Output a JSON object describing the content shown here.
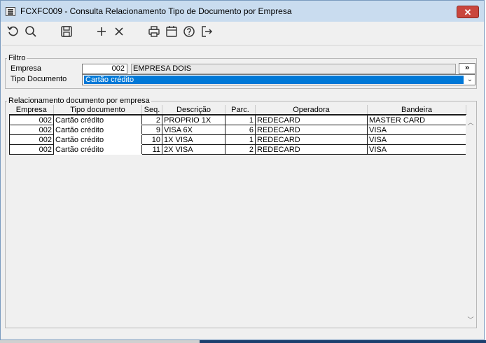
{
  "window": {
    "title": "FCXFC009 - Consulta Relacionamento Tipo de Documento por Empresa",
    "close_label": "✕"
  },
  "toolbar": {
    "icons": [
      "refresh-icon",
      "search-icon",
      "save-icon",
      "add-icon",
      "delete-icon",
      "print-icon",
      "calendar-icon",
      "help-icon",
      "exit-icon"
    ]
  },
  "filtro": {
    "legend": "Filtro",
    "empresa_label": "Empresa",
    "empresa_code": "002",
    "empresa_name": "EMPRESA DOIS",
    "lookup_label": "»",
    "tipo_label": "Tipo Documento",
    "tipo_value": "Cartão crédito"
  },
  "relacionamento": {
    "legend": "Relacionamento documento por empresa",
    "columns": [
      "Empresa",
      "Tipo documento",
      "Seq.",
      "Descrição",
      "Parc.",
      "Operadora",
      "Bandeira"
    ],
    "rows": [
      {
        "empresa": "002",
        "tipo": "Cartão crédito",
        "seq": "2",
        "descricao": "PROPRIO 1X",
        "parc": "1",
        "operadora": "REDECARD",
        "bandeira": "MASTER CARD"
      },
      {
        "empresa": "002",
        "tipo": "Cartão crédito",
        "seq": "9",
        "descricao": "VISA 6X",
        "parc": "6",
        "operadora": "REDECARD",
        "bandeira": "VISA"
      },
      {
        "empresa": "002",
        "tipo": "Cartão crédito",
        "seq": "10",
        "descricao": "1X VISA",
        "parc": "1",
        "operadora": "REDECARD",
        "bandeira": "VISA"
      },
      {
        "empresa": "002",
        "tipo": "Cartão crédito",
        "seq": "11",
        "descricao": "2X VISA",
        "parc": "2",
        "operadora": "REDECARD",
        "bandeira": "VISA"
      }
    ]
  },
  "colors": {
    "titlebar": "#c9dcef",
    "close": "#c9463d",
    "selection": "#0078d7"
  }
}
